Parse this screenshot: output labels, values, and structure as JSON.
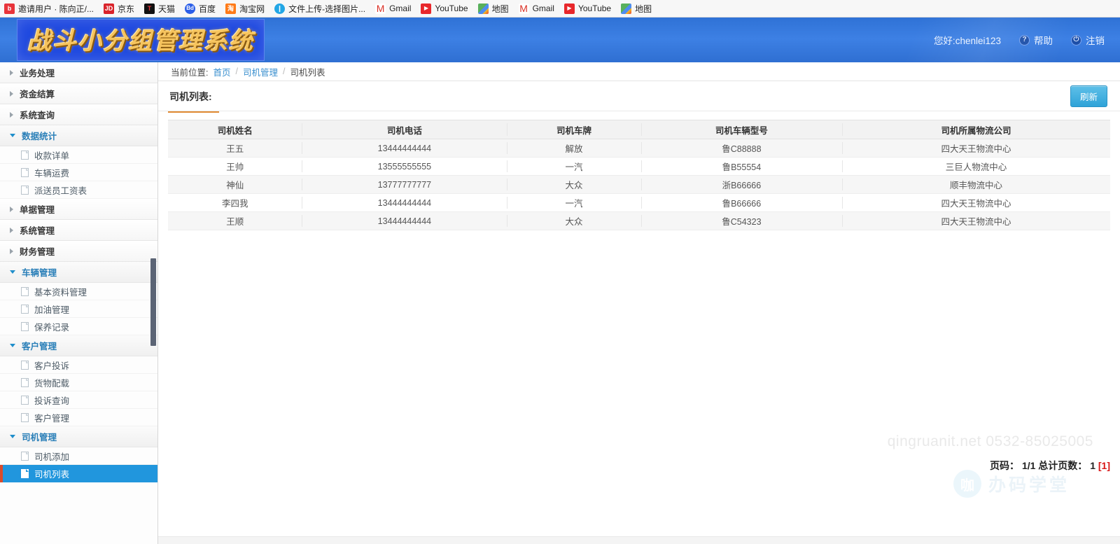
{
  "browser": {
    "bookmarks": [
      {
        "label": "邀请用户 · 陈向正/...",
        "icon": "meituan-icon",
        "glyph": "b",
        "cls": "ico-meituan"
      },
      {
        "label": "京东",
        "icon": "jd-icon",
        "glyph": "JD",
        "cls": "ico-jd"
      },
      {
        "label": "天猫",
        "icon": "tmall-icon",
        "glyph": "T",
        "cls": "ico-tmall"
      },
      {
        "label": "百度",
        "icon": "baidu-icon",
        "glyph": "Bd",
        "cls": "ico-baidu"
      },
      {
        "label": "淘宝网",
        "icon": "taobao-icon",
        "glyph": "淘",
        "cls": "ico-taobao"
      },
      {
        "label": "文件上传-选择图片...",
        "icon": "upload-icon",
        "glyph": "❙",
        "cls": "ico-upload"
      },
      {
        "label": "Gmail",
        "icon": "gmail-icon",
        "glyph": "M",
        "cls": "ico-gmail"
      },
      {
        "label": "YouTube",
        "icon": "youtube-icon",
        "glyph": "▶",
        "cls": "ico-youtube"
      },
      {
        "label": "地图",
        "icon": "maps-icon",
        "glyph": "",
        "cls": "ico-maps"
      },
      {
        "label": "Gmail",
        "icon": "gmail-icon",
        "glyph": "M",
        "cls": "ico-gmail"
      },
      {
        "label": "YouTube",
        "icon": "youtube-icon",
        "glyph": "▶",
        "cls": "ico-youtube"
      },
      {
        "label": "地图",
        "icon": "maps-icon",
        "glyph": "",
        "cls": "ico-maps"
      }
    ]
  },
  "header": {
    "logo_text": "战斗小分组管理系统",
    "greeting": "您好:chenlei123",
    "help_label": "帮助",
    "help_glyph": "?",
    "logout_label": "注销",
    "logout_glyph": "⏻"
  },
  "sidebar": {
    "groups": [
      {
        "label": "业务处理",
        "open": false,
        "items": []
      },
      {
        "label": "资金结算",
        "open": false,
        "items": []
      },
      {
        "label": "系统查询",
        "open": false,
        "items": []
      },
      {
        "label": "数据统计",
        "open": true,
        "items": [
          {
            "label": "收款详单",
            "active": false
          },
          {
            "label": "车辆运费",
            "active": false
          },
          {
            "label": "派送员工资表",
            "active": false
          }
        ]
      },
      {
        "label": "单据管理",
        "open": false,
        "items": []
      },
      {
        "label": "系统管理",
        "open": false,
        "items": []
      },
      {
        "label": "财务管理",
        "open": false,
        "items": []
      },
      {
        "label": "车辆管理",
        "open": true,
        "items": [
          {
            "label": "基本资料管理",
            "active": false
          },
          {
            "label": "加油管理",
            "active": false
          },
          {
            "label": "保养记录",
            "active": false
          }
        ]
      },
      {
        "label": "客户管理",
        "open": true,
        "items": [
          {
            "label": "客户投诉",
            "active": false
          },
          {
            "label": "货物配载",
            "active": false
          },
          {
            "label": "投诉查询",
            "active": false
          },
          {
            "label": "客户管理",
            "active": false
          }
        ]
      },
      {
        "label": "司机管理",
        "open": true,
        "items": [
          {
            "label": "司机添加",
            "active": false
          },
          {
            "label": "司机列表",
            "active": true
          }
        ]
      }
    ]
  },
  "breadcrumb": {
    "prefix": "当前位置:",
    "home": "首页",
    "sep": "/",
    "parent": "司机管理",
    "current": "司机列表"
  },
  "main": {
    "page_title": "司机列表:",
    "refresh_label": "刷新"
  },
  "table": {
    "columns": [
      "司机姓名",
      "司机电话",
      "司机车牌",
      "司机车辆型号",
      "司机所属物流公司"
    ],
    "rows": [
      [
        "王五",
        "13444444444",
        "解放",
        "鲁C88888",
        "四大天王物流中心"
      ],
      [
        "王帅",
        "13555555555",
        "一汽",
        "鲁B55554",
        "三巨人物流中心"
      ],
      [
        "神仙",
        "13777777777",
        "大众",
        "浙B66666",
        "顺丰物流中心"
      ],
      [
        "李四我",
        "13444444444",
        "一汽",
        "鲁B66666",
        "四大天王物流中心"
      ],
      [
        "王顺",
        "13444444444",
        "大众",
        "鲁C54323",
        "四大天王物流中心"
      ]
    ]
  },
  "pagination": {
    "text": "页码： 1/1 总计页数： 1 ",
    "current_page": "[1]"
  },
  "watermark": {
    "text": "qingruanit.net 0532-85025005",
    "logo_mark": "咖",
    "logo_label": "办码学堂"
  },
  "colors": {
    "brand_blue": "#2f72d6",
    "accent_orange": "#e08a32",
    "active_blue": "#2196dd",
    "active_marker_red": "#d94b2b",
    "refresh_blue": "#2fa3d8",
    "page_red": "#d81515"
  }
}
